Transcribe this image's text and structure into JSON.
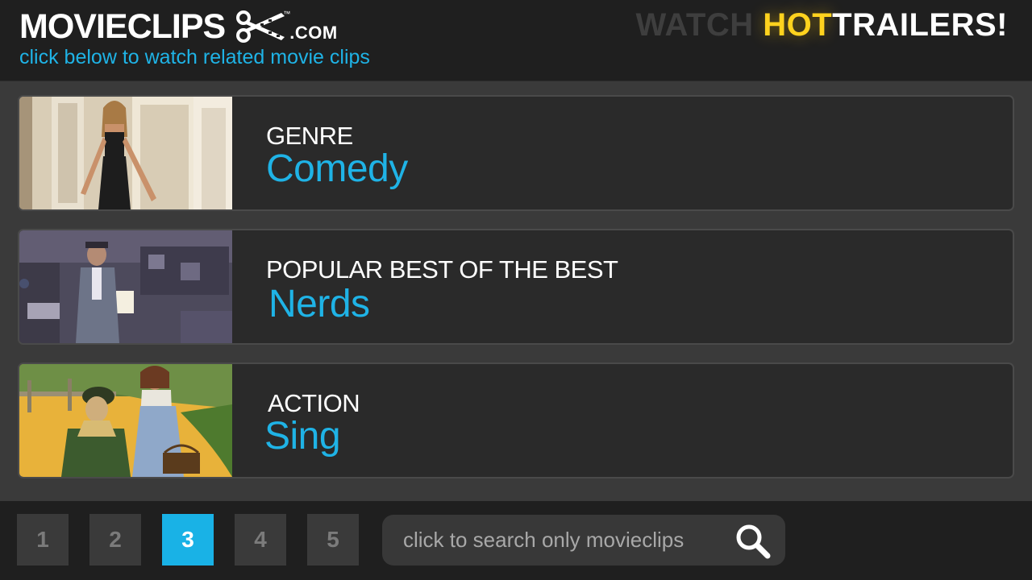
{
  "header": {
    "logo_text": "MOVIECLIPS",
    "logo_tm": "™",
    "logo_domain": ".COM",
    "tagline": "click below to watch related movie clips",
    "promo": {
      "word1": "WATCH ",
      "word2": "HOT",
      "word3": "TRAILERS!"
    }
  },
  "cards": [
    {
      "category": "GENRE",
      "title": "Comedy",
      "thumb_icon": "comedy-scene-thumbnail"
    },
    {
      "category": "POPULAR BEST OF THE BEST",
      "title": "Nerds",
      "thumb_icon": "nerds-scene-thumbnail"
    },
    {
      "category": "ACTION",
      "title": "Sing",
      "thumb_icon": "sing-scene-thumbnail"
    }
  ],
  "pagination": {
    "pages": [
      "1",
      "2",
      "3",
      "4",
      "5"
    ],
    "active_page": "3"
  },
  "search": {
    "placeholder": "click to search only movieclips",
    "icon": "search-icon"
  },
  "colors": {
    "accent": "#1fb3e6",
    "promo_hot": "#ffd21e",
    "background": "#3a3a3a",
    "header": "#1f1f1f"
  }
}
